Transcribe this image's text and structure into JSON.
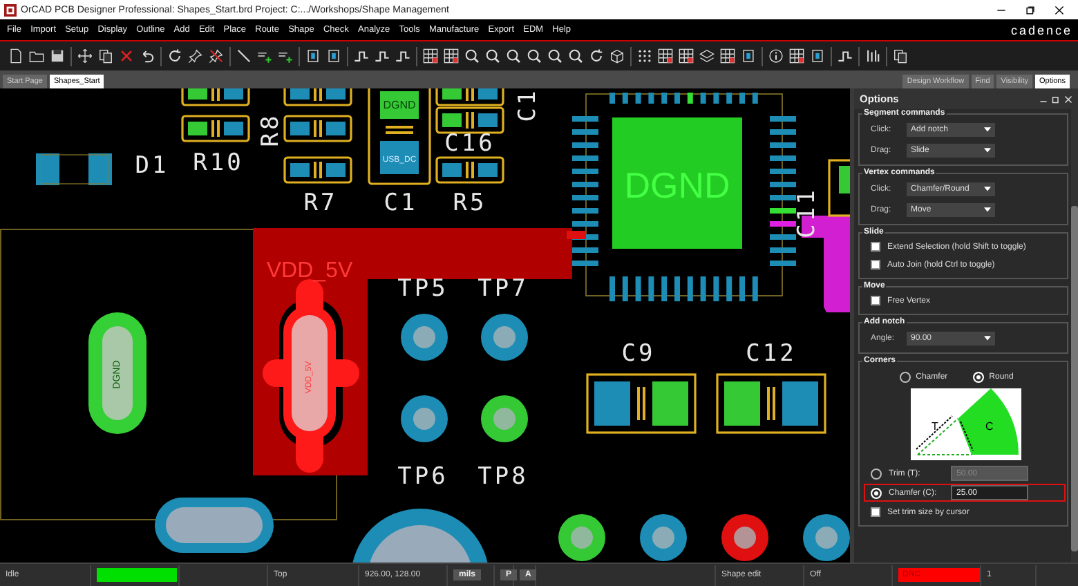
{
  "window": {
    "title": "OrCAD PCB Designer Professional: Shapes_Start.brd  Project: C:.../Workshops/Shape Management"
  },
  "menu": [
    "File",
    "Import",
    "Setup",
    "Display",
    "Outline",
    "Add",
    "Edit",
    "Place",
    "Route",
    "Shape",
    "Check",
    "Analyze",
    "Tools",
    "Manufacture",
    "Export",
    "EDM",
    "Help"
  ],
  "brand": "cadence",
  "doc_tabs": [
    {
      "label": "Start Page",
      "selected": false
    },
    {
      "label": "Shapes_Start",
      "selected": true
    }
  ],
  "panel_tabs": [
    {
      "label": "Design Workflow",
      "selected": false
    },
    {
      "label": "Find",
      "selected": false
    },
    {
      "label": "Visibility",
      "selected": false
    },
    {
      "label": "Options",
      "selected": true
    }
  ],
  "options": {
    "title": "Options",
    "sections": [
      {
        "title": "Segment commands",
        "rows": [
          {
            "kind": "dropdown",
            "label": "Click:",
            "value": "Add notch"
          },
          {
            "kind": "dropdown",
            "label": "Drag:",
            "value": "Slide"
          }
        ]
      },
      {
        "title": "Vertex commands",
        "rows": [
          {
            "kind": "dropdown",
            "label": "Click:",
            "value": "Chamfer/Round"
          },
          {
            "kind": "dropdown",
            "label": "Drag:",
            "value": "Move"
          }
        ]
      },
      {
        "title": "Slide",
        "rows": [
          {
            "kind": "checkbox",
            "label": "Extend Selection (hold Shift to toggle)",
            "checked": false
          },
          {
            "kind": "checkbox",
            "label": "Auto Join (hold Ctrl to toggle)",
            "checked": false
          }
        ]
      },
      {
        "title": "Move",
        "rows": [
          {
            "kind": "checkbox",
            "label": "Free Vertex",
            "checked": false
          }
        ]
      },
      {
        "title": "Add notch",
        "rows": [
          {
            "kind": "dropdown",
            "label": "Angle:",
            "value": "90.00"
          }
        ]
      },
      {
        "title": "Corners",
        "rows": [
          {
            "kind": "radios",
            "options": [
              {
                "label": "Chamfer",
                "selected": false
              },
              {
                "label": "Round",
                "selected": true
              }
            ]
          },
          {
            "kind": "diagram",
            "labels": [
              "T",
              "C"
            ]
          },
          {
            "kind": "field",
            "label": "Trim (T):",
            "value": "50.00",
            "selected": false,
            "disabled": true,
            "highlighted": false
          },
          {
            "kind": "field",
            "label": "Chamfer (C):",
            "value": "25.00",
            "selected": true,
            "disabled": false,
            "highlighted": true
          },
          {
            "kind": "checkbox",
            "label": "Set trim size by cursor",
            "checked": false
          }
        ]
      }
    ]
  },
  "board": {
    "refdes": [
      "C1",
      "R8",
      "C16",
      "D1",
      "R10",
      "R7",
      "C1",
      "R5",
      "C11",
      "TP5",
      "TP7",
      "C9",
      "C12",
      "TP6",
      "TP8"
    ],
    "nets": [
      "DGND",
      "USB_DC",
      "DGND",
      "VDD_5V",
      "VDD_5V",
      "DGND"
    ]
  },
  "status_bar": [
    {
      "kind": "text",
      "text": "Idle"
    },
    {
      "kind": "indicator",
      "color": "#00e000"
    },
    {
      "kind": "text",
      "text": "Top"
    },
    {
      "kind": "text",
      "text": "926.00, 128.00"
    },
    {
      "kind": "button",
      "text": "mils"
    },
    {
      "kind": "button",
      "text": "P"
    },
    {
      "kind": "button",
      "text": "A"
    },
    {
      "kind": "text",
      "text": "Shape edit"
    },
    {
      "kind": "text",
      "text": "Off"
    },
    {
      "kind": "badge",
      "text": "DRC",
      "color": "#ff0000"
    },
    {
      "kind": "text",
      "text": "1"
    }
  ]
}
